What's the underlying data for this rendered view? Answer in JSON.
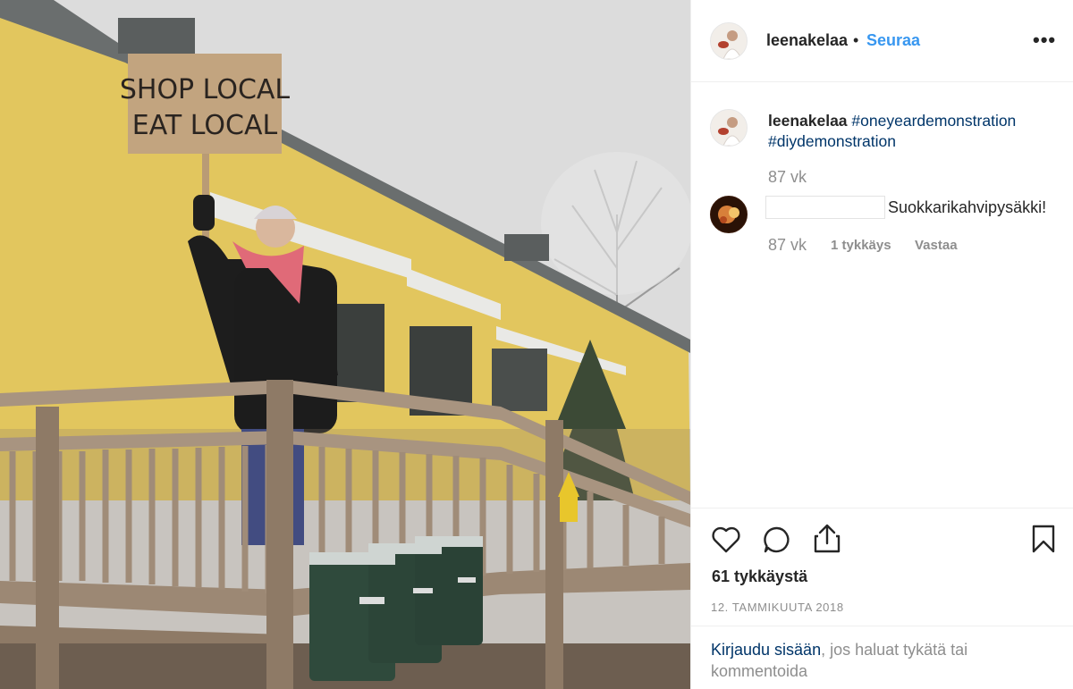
{
  "photo": {
    "sign_line1": "SHOP LOCAL",
    "sign_line2": "EAT LOCAL"
  },
  "header": {
    "username": "leenakelaa",
    "separator": "•",
    "follow_label": "Seuraa",
    "more_label": "•••"
  },
  "caption": {
    "username": "leenakelaa",
    "hashtag1": "#oneyeardemonstration",
    "hashtag2": "#diydemonstration",
    "time": "87 vk"
  },
  "comment": {
    "text": "Suokkarikahvipysäkki!",
    "time": "87 vk",
    "likes": "1 tykkäys",
    "reply_label": "Vastaa"
  },
  "actions": {
    "icons": [
      "heart-icon",
      "comment-icon",
      "share-icon",
      "bookmark-icon"
    ],
    "like_count": "61 tykkäystä",
    "date": "12. TAMMIKUUTA 2018"
  },
  "login": {
    "link_text": "Kirjaudu sisään",
    "rest_text": ", jos haluat tykätä tai kommentoida"
  },
  "colors": {
    "link_blue": "#3897f0",
    "hashtag_blue": "#003569",
    "muted": "#8e8e8e",
    "text": "#262626"
  }
}
